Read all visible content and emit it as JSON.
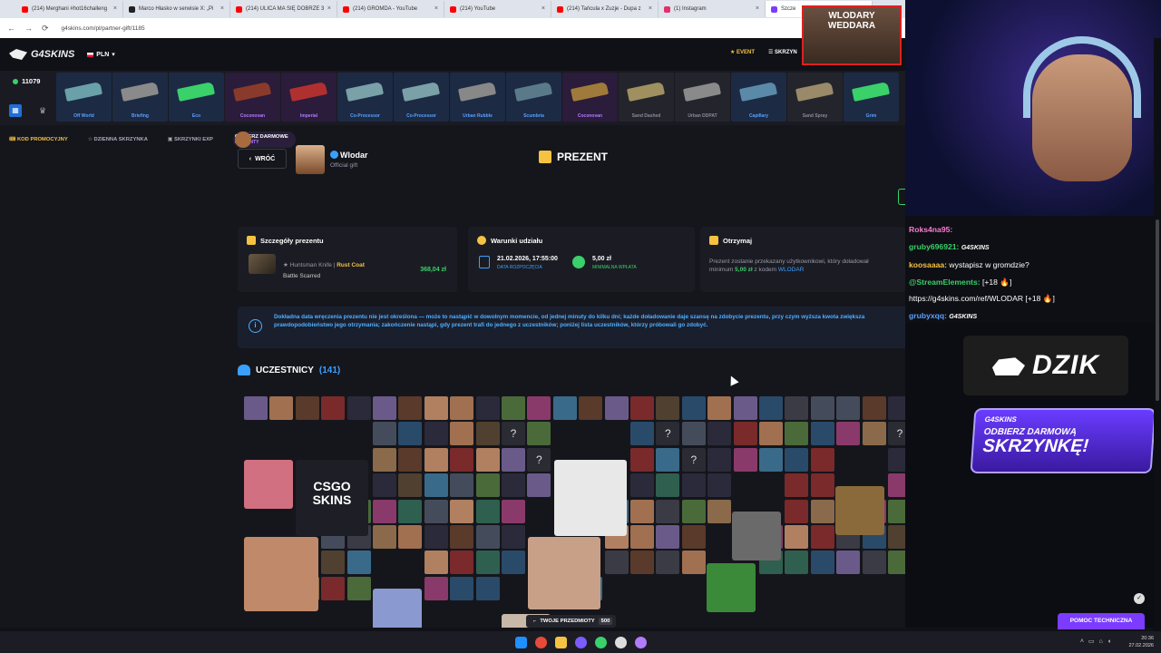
{
  "browser": {
    "tabs": [
      {
        "label": "(214) Merghani #hot16challeng",
        "color": "#ff0000"
      },
      {
        "label": "Marco Hłasko w serwisie X: „Pi",
        "color": "#222222"
      },
      {
        "label": "(214) ULICA MA SIĘ DOBRZE 3",
        "color": "#ff0000"
      },
      {
        "label": "(214) GROMDA - YouTube",
        "color": "#ff0000"
      },
      {
        "label": "(214) YouTube",
        "color": "#ff0000"
      },
      {
        "label": "(214) Tańcula x Zuzje - Dupa z",
        "color": "#ff0000"
      },
      {
        "label": "(1) Instagram",
        "color": "#e1306c"
      },
      {
        "label": "Szcze",
        "color": "#7b3cff"
      }
    ],
    "url": "g4skins.com/pl/partner-gift/1185"
  },
  "site": {
    "logo": "G4SKINS",
    "currency": "PLN",
    "event": "EVENT",
    "skrzynki": "SKRZYN",
    "balance": "11079",
    "drops": [
      {
        "name": "Off World",
        "bg": "#1c2a44",
        "gun": "#6aa0a8",
        "nameColor": "#5aa0ff"
      },
      {
        "name": "Briefing",
        "bg": "#1c2a44",
        "gun": "#8a8a8a",
        "nameColor": "#5aa0ff"
      },
      {
        "name": "Eco",
        "bg": "#1c2a44",
        "gun": "#3ad06a",
        "nameColor": "#5aa0ff"
      },
      {
        "name": "Coconovan",
        "bg": "#2a1c3a",
        "gun": "#8a3a2a",
        "nameColor": "#b07cff"
      },
      {
        "name": "Imperial",
        "bg": "#2a1c3a",
        "gun": "#b03030",
        "nameColor": "#b07cff"
      },
      {
        "name": "Co-Processor",
        "bg": "#1c2a44",
        "gun": "#7aa0a8",
        "nameColor": "#5aa0ff"
      },
      {
        "name": "Co-Processor",
        "bg": "#1c2a44",
        "gun": "#7aa0a8",
        "nameColor": "#5aa0ff"
      },
      {
        "name": "Urban Rubble",
        "bg": "#1c2a44",
        "gun": "#888888",
        "nameColor": "#5aa0ff"
      },
      {
        "name": "Scumbria",
        "bg": "#1c2a44",
        "gun": "#5a7a8a",
        "nameColor": "#5aa0ff"
      },
      {
        "name": "Coconovan",
        "bg": "#2a1c3a",
        "gun": "#a07a3a",
        "nameColor": "#b07cff"
      },
      {
        "name": "Sand Dashed",
        "bg": "#24252c",
        "gun": "#a09060",
        "nameColor": "#8a8a99"
      },
      {
        "name": "Urban DDPAT",
        "bg": "#24252c",
        "gun": "#8a8a8a",
        "nameColor": "#8a8a99"
      },
      {
        "name": "Capillary",
        "bg": "#1c2a44",
        "gun": "#5a8aa8",
        "nameColor": "#5aa0ff"
      },
      {
        "name": "Sand Spray",
        "bg": "#24252c",
        "gun": "#9a8a6a",
        "nameColor": "#8a8a99"
      },
      {
        "name": "Grim",
        "bg": "#1c2a44",
        "gun": "#3ad06a",
        "nameColor": "#5aa0ff"
      }
    ],
    "subnav": {
      "promo": "KOD PROMOCYJNY",
      "daily": "DZIENNA SKRZYNKA",
      "exp": "SKRZYNKI EXP",
      "free_title": "ODBIERZ DARMOWE",
      "free_sub": "PREZENTY"
    }
  },
  "page": {
    "back": "WRÓĆ",
    "host_name": "Wlodar",
    "host_sub": "Official gift",
    "title": "PREZENT",
    "gift_card": {
      "heading": "Szczegóły prezentu",
      "weapon": "★ Huntsman Knife | ",
      "skin": "Rust Coat",
      "wear": "Battle Scarred",
      "price": "368,04 zł"
    },
    "conditions": {
      "heading": "Warunki udziału",
      "date": "21.02.2026, 17:55:00",
      "date_label": "DATA ROZPOCZĘCIA",
      "min": "5,00 zł",
      "min_label": "MINIMALNA WPŁATA"
    },
    "receive": {
      "heading": "Otrzymaj",
      "text_a": "Prezent zostanie przekazany użytkownikowi, który doładował minimum ",
      "amount": "5,00 zł",
      "text_b": " z kodem ",
      "code": "WLODAR"
    },
    "info": "Dokładna data wręczenia prezentu nie jest określona — może to nastąpić w dowolnym momencie, od jednej minuty do kilku dni; każde doładowanie daje szansę na zdobycie prezentu, przy czym wyższa kwota zwiększa prawdopodobieństwo jego otrzymania; zakończenie nastąpi, gdy prezent trafi do jednego z uczestników; poniżej lista uczestników, którzy próbowali go zdobyć.",
    "participants_label": "UCZESTNICY",
    "participants_count": "(141)",
    "csgo_big": "CSGO SKINS",
    "items_label": "TWOJE PRZEDMIOTY",
    "items_count": "500"
  },
  "overlay": {
    "chat": [
      {
        "user": "Roks4na95:",
        "msg": "",
        "cls": "u1"
      },
      {
        "user": "gruby696921:",
        "msg": "",
        "tag": "G4SKINS",
        "cls": "u2"
      },
      {
        "user": "koosaaaa:",
        "msg": " wystapisz w gromdzie?",
        "cls": "u3"
      },
      {
        "user": "@StreamElements:",
        "msg": " [+18 🔥]",
        "cls": "u4"
      },
      {
        "user": "",
        "msg": "https://g4skins.com/ref/WLODAR [+18 🔥]",
        "cls": "u4"
      },
      {
        "user": "grubyxqq:",
        "msg": "",
        "tag": "G4SKINS",
        "cls": "u5"
      }
    ],
    "sign": "WLODARY WEDDARA",
    "dzik": "DZIK",
    "banner_brand": "G4SKINS",
    "banner_l1": "ODBIERZ DARMOWĄ",
    "banner_l2": "SKRZYNKĘ!",
    "help": "POMOC TECHNICZNA"
  },
  "taskbar": {
    "time": "20:36",
    "date": "27.02.2026"
  }
}
